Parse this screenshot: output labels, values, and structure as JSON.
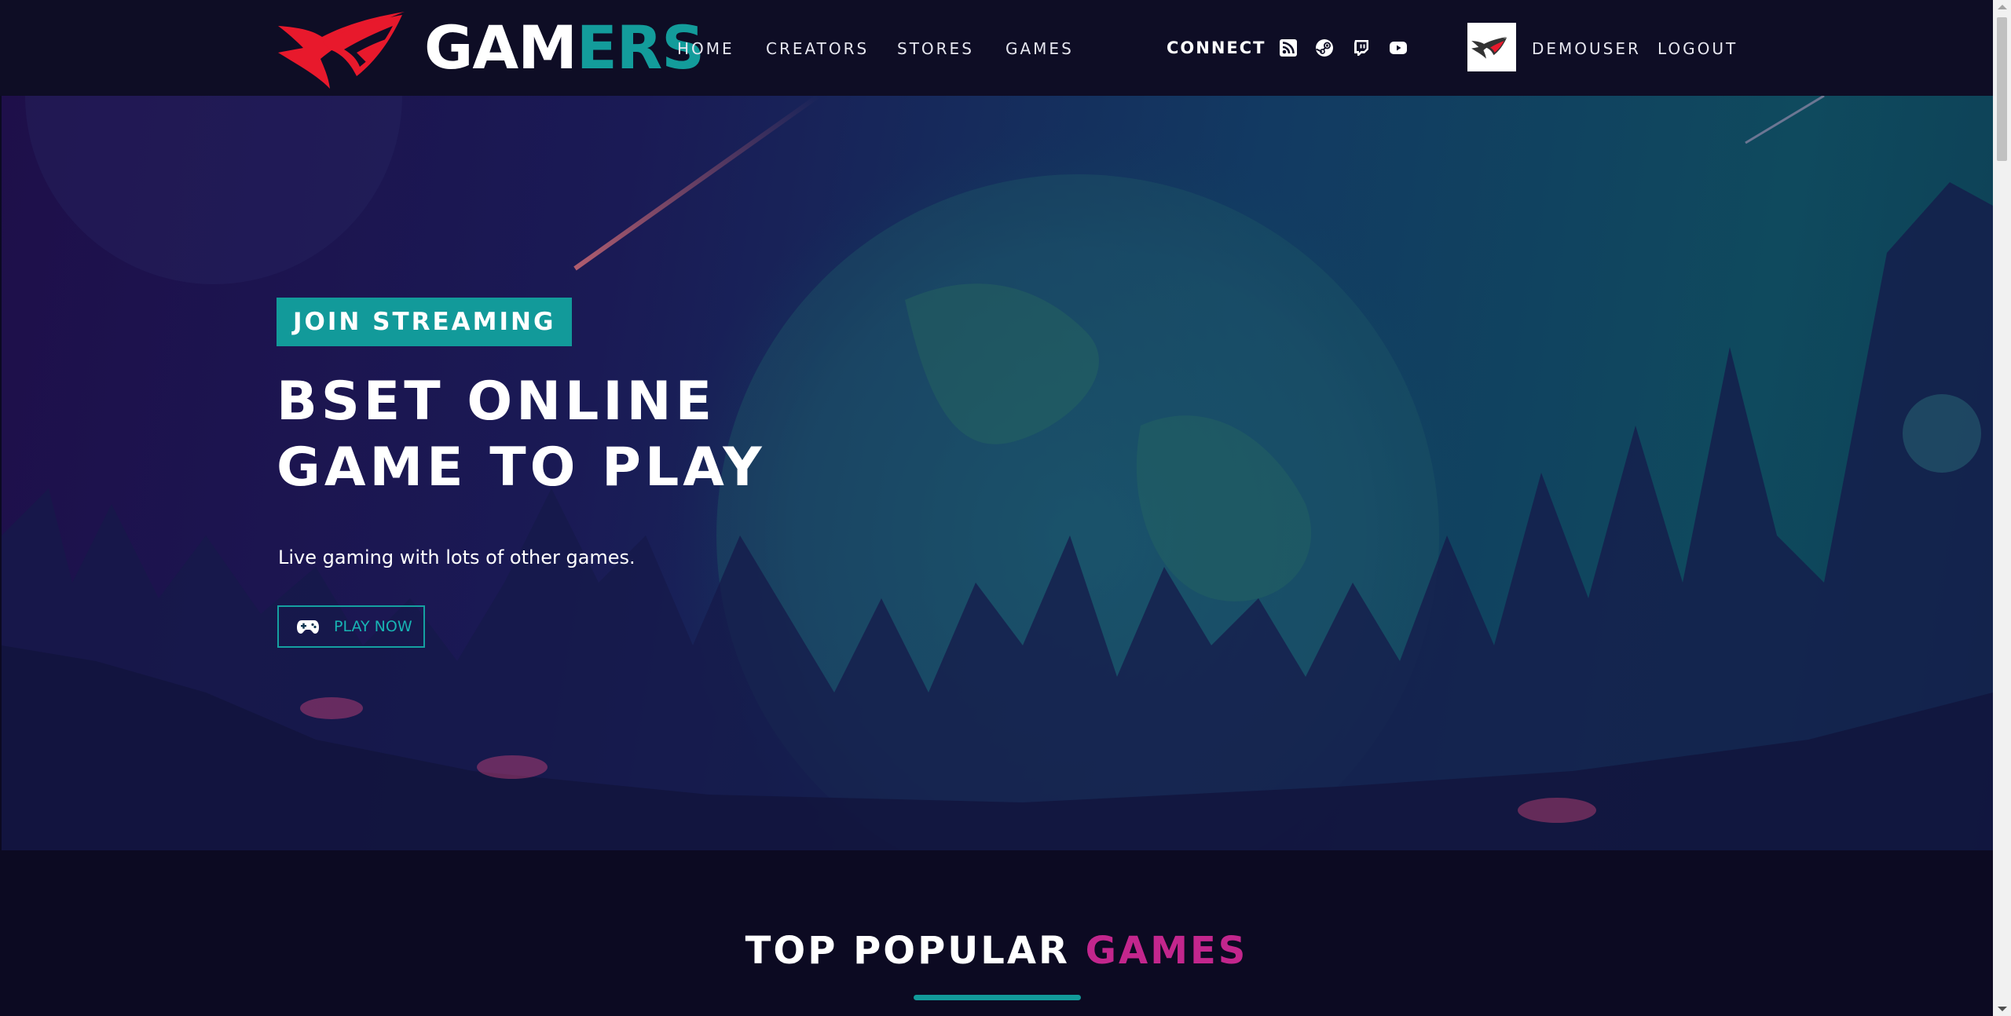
{
  "header": {
    "logo": {
      "text_white": "GAM",
      "text_teal": "ERS"
    },
    "nav": [
      {
        "label": "HOME"
      },
      {
        "label": "CREATORS"
      },
      {
        "label": "STORES"
      },
      {
        "label": "GAMES"
      }
    ],
    "connect_label": "CONNECT",
    "social_icons": [
      "rss-icon",
      "steam-icon",
      "twitch-icon",
      "youtube-icon"
    ],
    "user": {
      "name": "DEMOUSER"
    },
    "logout_label": "LOGOUT"
  },
  "hero": {
    "tag": "JOIN STREAMING",
    "title_line1": "BSET ONLINE",
    "title_line2": "GAME TO PLAY",
    "subtitle": "Live gaming with lots of other games.",
    "cta_label": "PLAY NOW"
  },
  "section": {
    "title_white": "TOP POPULAR ",
    "title_accent": "GAMES"
  },
  "colors": {
    "teal": "#129a9a",
    "brand_red": "#e8192c",
    "accent_magenta": "#c3268d",
    "header_bg": "#0e0d25"
  }
}
